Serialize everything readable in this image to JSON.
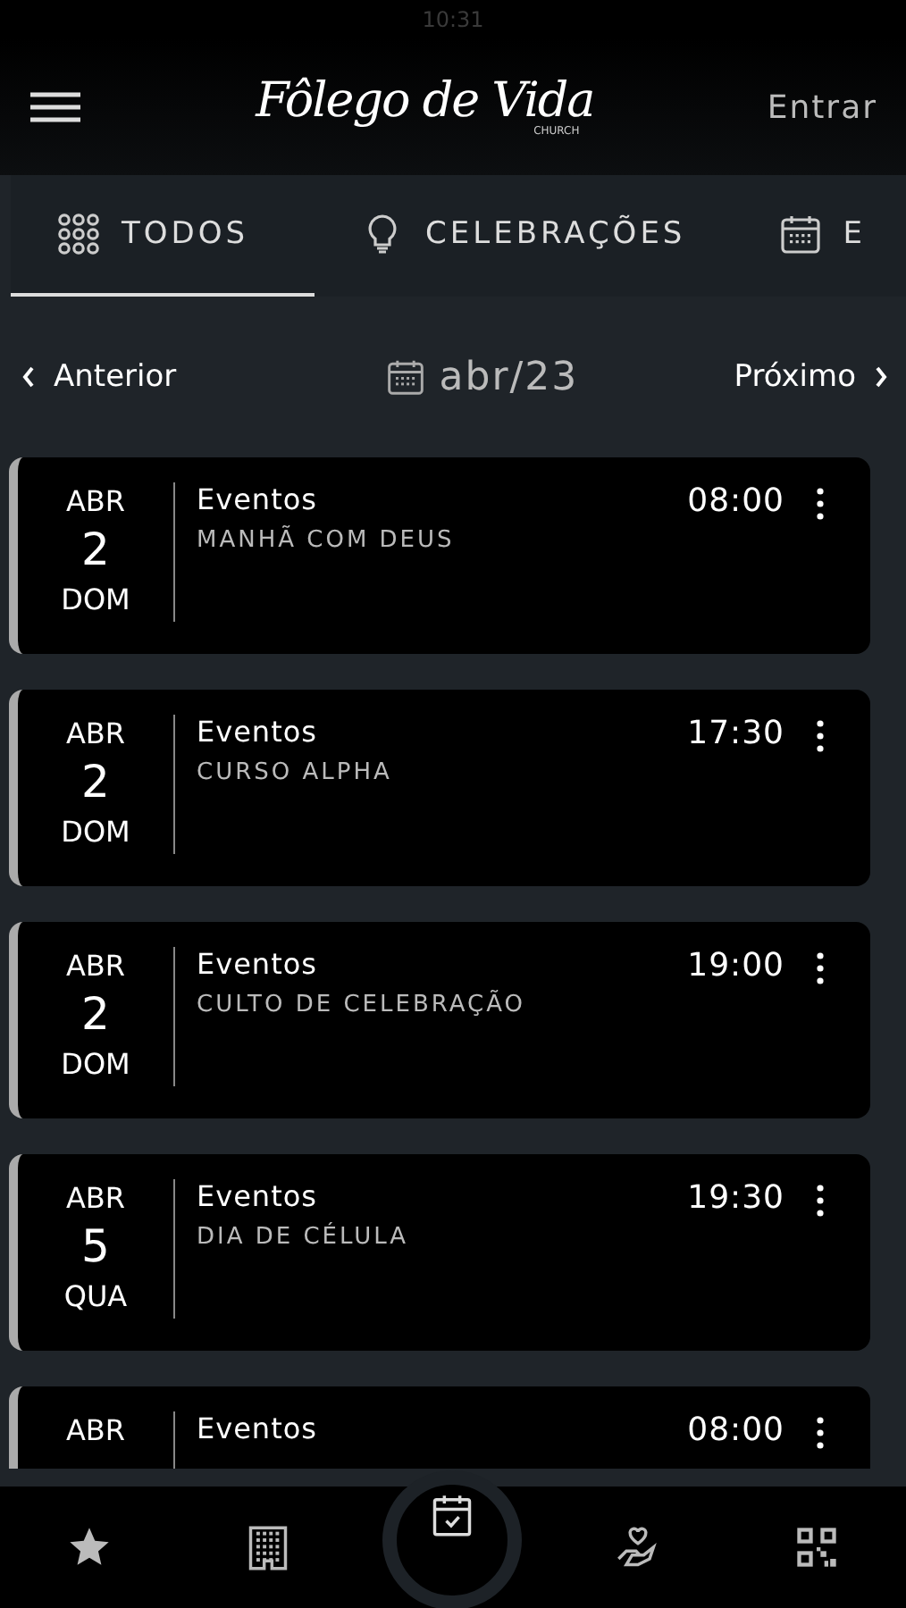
{
  "status_bar": {
    "time": "10:31"
  },
  "header": {
    "logo": "Fôlego de Vida",
    "logo_sub": "CHURCH",
    "login": "Entrar"
  },
  "tabs": [
    {
      "label": "TODOS",
      "selected": true
    },
    {
      "label": "CELEBRAÇÕES",
      "selected": false
    },
    {
      "label": "E",
      "selected": false
    }
  ],
  "month_nav": {
    "previous": "Anterior",
    "month": "abr/23",
    "next": "Próximo"
  },
  "events": [
    {
      "month": "ABR",
      "day": "2",
      "weekday": "DOM",
      "category": "Eventos",
      "title": "MANHÃ COM DEUS",
      "time": "08:00"
    },
    {
      "month": "ABR",
      "day": "2",
      "weekday": "DOM",
      "category": "Eventos",
      "title": "CURSO ALPHA",
      "time": "17:30"
    },
    {
      "month": "ABR",
      "day": "2",
      "weekday": "DOM",
      "category": "Eventos",
      "title": "CULTO DE CELEBRAÇÃO",
      "time": "19:00"
    },
    {
      "month": "ABR",
      "day": "5",
      "weekday": "QUA",
      "category": "Eventos",
      "title": "DIA DE CÉLULA",
      "time": "19:30"
    },
    {
      "month": "ABR",
      "category": "Eventos",
      "time": "08:00"
    }
  ],
  "bottom_nav": [
    {
      "selected": false
    },
    {
      "selected": false
    },
    {
      "selected": true
    },
    {
      "selected": false
    },
    {
      "selected": false
    }
  ]
}
